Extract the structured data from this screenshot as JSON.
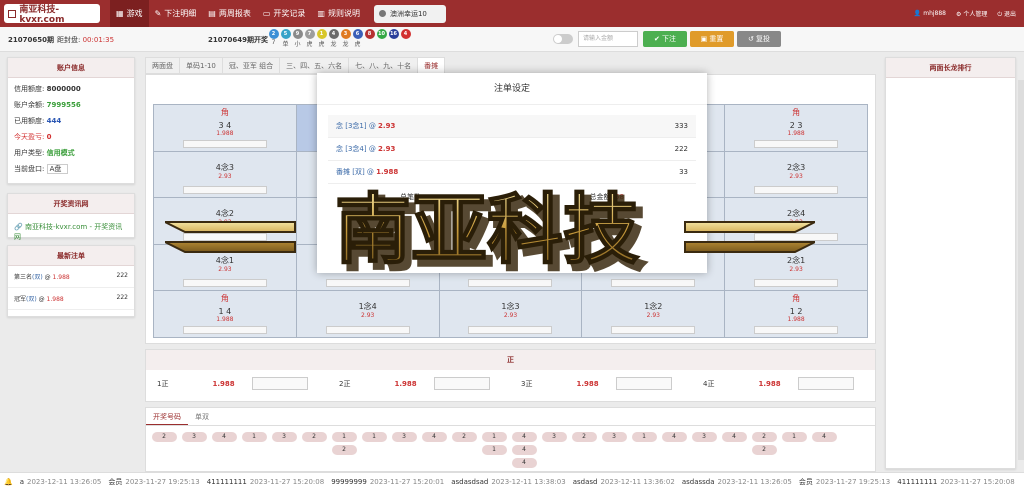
{
  "brand": {
    "logo_text": "南亚科技-kvxr.com"
  },
  "nav": [
    {
      "icon": "▦",
      "label": "游戏",
      "active": true
    },
    {
      "icon": "✎",
      "label": "下注明细"
    },
    {
      "icon": "▤",
      "label": "两周报表"
    },
    {
      "icon": "▭",
      "label": "开奖记录"
    },
    {
      "icon": "▥",
      "label": "规则说明"
    }
  ],
  "game_select": "澳洲幸运10",
  "user": {
    "name": "mhj888",
    "profile": "个人管理",
    "logout": "退出"
  },
  "issue": {
    "current": "21070650期",
    "close_label": "距封盘:",
    "countdown": "00:01:35",
    "last": "21070649期开奖",
    "balls": [
      {
        "n": "2",
        "color": "#3c8fd6",
        "sub": "7"
      },
      {
        "n": "5",
        "color": "#36a3c9",
        "sub": "单"
      },
      {
        "n": "9",
        "color": "#8a8a8a",
        "sub": "小"
      },
      {
        "n": "7",
        "color": "#9d9d9d",
        "sub": "虎"
      },
      {
        "n": "1",
        "color": "#d8c72a",
        "sub": "虎"
      },
      {
        "n": "4",
        "color": "#6b6b6b",
        "sub": "龙"
      },
      {
        "n": "3",
        "color": "#e07a22",
        "sub": "龙"
      },
      {
        "n": "6",
        "color": "#3b5fb8",
        "sub": "虎"
      },
      {
        "n": "8",
        "color": "#b63131",
        "sub": ""
      },
      {
        "n": "10",
        "color": "#35a845",
        "sub": ""
      },
      {
        "n": "16",
        "color": "#2a3e9a",
        "sub": ""
      },
      {
        "n": "4",
        "color": "#d23030",
        "sub": ""
      }
    ]
  },
  "controls": {
    "amount_placeholder": "请输入金额",
    "bet": "下注",
    "reset": "重置",
    "resubmit": "复投"
  },
  "account": {
    "title": "账户信息",
    "rows": [
      {
        "k": "信用额度:",
        "v": "8000000",
        "color": "#333"
      },
      {
        "k": "账户余额:",
        "v": "7999556",
        "color": "#3a9e3a"
      },
      {
        "k": "已用额度:",
        "v": "444",
        "color": "#2a56b3"
      },
      {
        "k": "今天盈亏:",
        "v": "0",
        "color": "#d23030",
        "kcolor": "#d23030"
      },
      {
        "k": "用户类型:",
        "v": "信用模式",
        "color": "#3a9e3a"
      },
      {
        "k": "当前盘口:",
        "v": "A盘",
        "color": "#333"
      }
    ]
  },
  "news": {
    "title": "开奖资讯网",
    "link": "南亚科技-kvxr.com - 开奖资讯网"
  },
  "latest": {
    "title": "最新注单",
    "rows": [
      {
        "label": "第三名",
        "detail": "(双)",
        "odds": "1.988",
        "amt": "222"
      },
      {
        "label": "冠军",
        "detail": "(双)",
        "odds": "1.988",
        "amt": "222"
      }
    ]
  },
  "tabs": [
    "两面盘",
    "单码1-10",
    "冠、亚军 组合",
    "三、四、五、六名",
    "七、八、九、十名",
    "番摊"
  ],
  "fantan": {
    "rows": [
      [
        {
          "jiao": "角",
          "name": "3 4",
          "odds": "1.988"
        },
        {
          "name": "",
          "odds": ""
        },
        {
          "name": "",
          "odds": ""
        },
        {
          "name": "",
          "odds": ""
        },
        {
          "jiao": "角",
          "name": "2 3",
          "odds": "1.988"
        }
      ],
      [
        {
          "name": "4念3",
          "odds": "2.93"
        },
        {
          "name": "",
          "odds": ""
        },
        {
          "name": "",
          "odds": ""
        },
        {
          "name": "",
          "odds": ""
        },
        {
          "name": "2念3",
          "odds": "2.93"
        }
      ],
      [
        {
          "name": "4念2",
          "odds": "2.93"
        },
        {
          "name": "",
          "odds": ""
        },
        {
          "name": "",
          "odds": ""
        },
        {
          "name": "",
          "odds": ""
        },
        {
          "name": "2念4",
          "odds": "2.93"
        }
      ],
      [
        {
          "name": "4念1",
          "odds": "2.93"
        },
        {
          "name": "",
          "odds": ""
        },
        {
          "name": "1番",
          "odds": "3.93"
        },
        {
          "name": "",
          "odds": ""
        },
        {
          "name": "2念1",
          "odds": "2.93"
        }
      ],
      [
        {
          "jiao": "角",
          "name": "1 4",
          "odds": "1.988"
        },
        {
          "name": "1念4",
          "odds": "2.93"
        },
        {
          "name": "1念3",
          "odds": "2.93"
        },
        {
          "name": "1念2",
          "odds": "2.93"
        },
        {
          "jiao": "角",
          "name": "1 2",
          "odds": "1.988"
        }
      ]
    ]
  },
  "zheng": {
    "title": "正",
    "items": [
      {
        "name": "1正",
        "odds": "1.988"
      },
      {
        "name": "2正",
        "odds": "1.988"
      },
      {
        "name": "3正",
        "odds": "1.988"
      },
      {
        "name": "4正",
        "odds": "1.988"
      }
    ]
  },
  "history": {
    "tabs": [
      "开奖号码",
      "单双"
    ],
    "cols": [
      [
        "2"
      ],
      [
        "3"
      ],
      [
        "4"
      ],
      [
        "1"
      ],
      [
        "3"
      ],
      [
        "2"
      ],
      [
        "1",
        "2"
      ],
      [
        "1"
      ],
      [
        "3"
      ],
      [
        "4"
      ],
      [
        "2"
      ],
      [
        "1",
        "1"
      ],
      [
        "4",
        "4",
        "4"
      ],
      [
        "3"
      ],
      [
        "2"
      ],
      [
        "3"
      ],
      [
        "1"
      ],
      [
        "4"
      ],
      [
        "3"
      ],
      [
        "4"
      ],
      [
        "2",
        "2"
      ],
      [
        "1"
      ],
      [
        "4"
      ]
    ]
  },
  "dialog": {
    "title": "注单设定",
    "rows": [
      {
        "bet": "念 [3念1] @",
        "odds": "2.93",
        "amt": "333"
      },
      {
        "bet": "念 [3念4] @",
        "odds": "2.93",
        "amt": "222"
      },
      {
        "bet": "番摊 [双] @",
        "odds": "1.988",
        "amt": "33"
      }
    ],
    "sum1": "总笔数:",
    "sum2": "总金额:",
    "sum2_value": "58"
  },
  "watermark": "南亚科技",
  "right_panel": {
    "title": "两面长龙排行"
  },
  "ticker": [
    {
      "name": "a",
      "time": "2023-12-11 13:26:05"
    },
    {
      "name": "会员",
      "time": "2023-11-27 19:25:13"
    },
    {
      "name": "411111111",
      "time": "2023-11-27 15:20:08"
    },
    {
      "name": "99999999",
      "time": "2023-11-27 15:20:01"
    },
    {
      "name": "asdasdsad",
      "time": "2023-12-11 13:38:03"
    },
    {
      "name": "asdasd",
      "time": "2023-12-11 13:36:02"
    },
    {
      "name": "asdassda",
      "time": "2023-12-11 13:26:05"
    },
    {
      "name": "会员",
      "time": "2023-11-27 19:25:13"
    },
    {
      "name": "411111111",
      "time": "2023-11-27 15:20:08"
    }
  ]
}
